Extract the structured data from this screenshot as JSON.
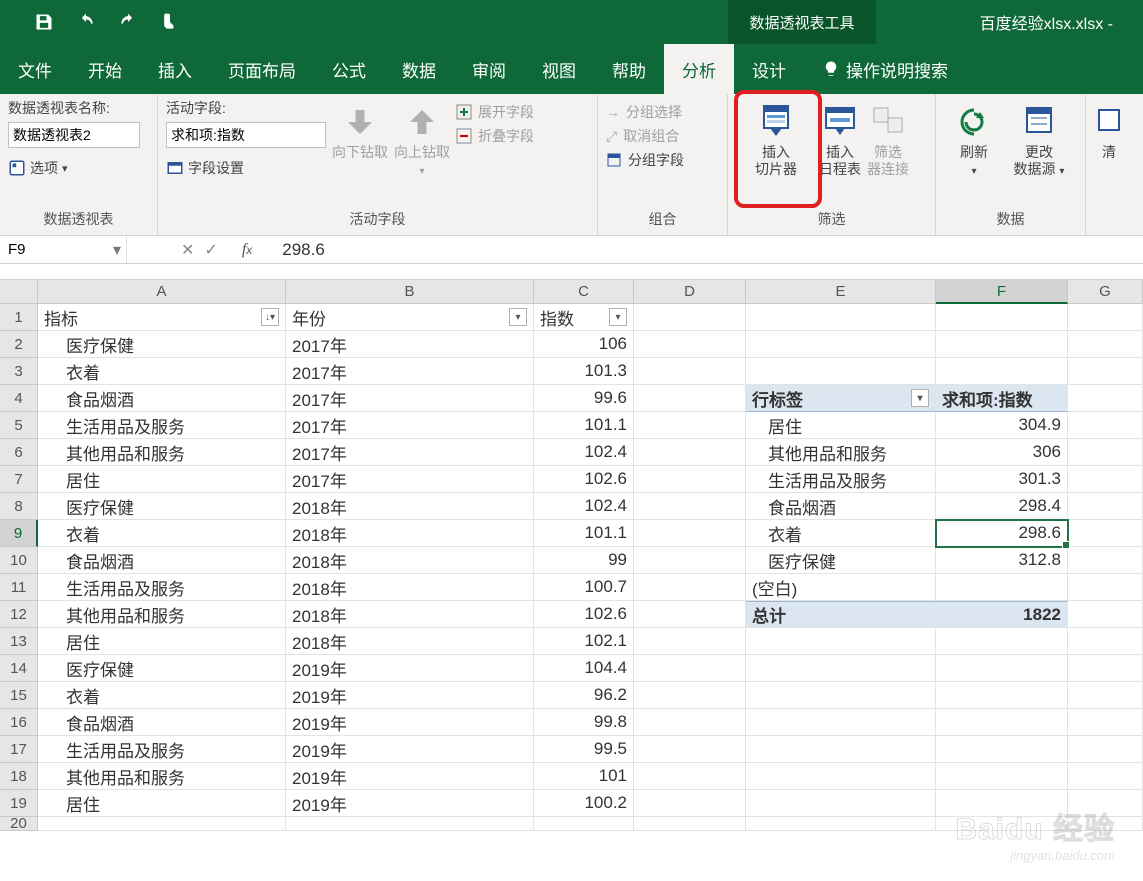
{
  "title": {
    "context_tab": "数据透视表工具",
    "filename": "百度经验xlsx.xlsx -"
  },
  "tabs": [
    "文件",
    "开始",
    "插入",
    "页面布局",
    "公式",
    "数据",
    "审阅",
    "视图",
    "帮助",
    "分析",
    "设计"
  ],
  "tell_me": "操作说明搜索",
  "ribbon": {
    "g1": {
      "label": "数据透视表名称:",
      "value": "数据透视表2",
      "options": "选项",
      "group": "数据透视表"
    },
    "g2": {
      "label": "活动字段:",
      "value": "求和项:指数",
      "settings": "字段设置",
      "drilldown": "向下钻取",
      "drillup": "向上钻取",
      "expand": "展开字段",
      "collapse": "折叠字段",
      "group": "活动字段"
    },
    "g3": {
      "sel": "分组选择",
      "ungroup": "取消组合",
      "field": "分组字段",
      "group": "组合"
    },
    "g4": {
      "slicer1": "插入",
      "slicer2": "切片器",
      "timeline1": "插入",
      "timeline2": "日程表",
      "conn1": "筛选",
      "conn2": "器连接",
      "group": "筛选"
    },
    "g5": {
      "refresh": "刷新",
      "source1": "更改",
      "source2": "数据源",
      "group": "数据"
    },
    "g6": {
      "clear": "清"
    }
  },
  "namebox": "F9",
  "formula": "298.6",
  "columns": [
    "A",
    "B",
    "C",
    "D",
    "E",
    "F",
    "G"
  ],
  "headers": {
    "A": "指标",
    "B": "年份",
    "C": "指数"
  },
  "rows": [
    {
      "n": "1"
    },
    {
      "n": "2",
      "a": "医疗保健",
      "b": "2017年",
      "c": "106"
    },
    {
      "n": "3",
      "a": "衣着",
      "b": "2017年",
      "c": "101.3"
    },
    {
      "n": "4",
      "a": "食品烟酒",
      "b": "2017年",
      "c": "99.6"
    },
    {
      "n": "5",
      "a": "生活用品及服务",
      "b": "2017年",
      "c": "101.1"
    },
    {
      "n": "6",
      "a": "其他用品和服务",
      "b": "2017年",
      "c": "102.4"
    },
    {
      "n": "7",
      "a": "居住",
      "b": "2017年",
      "c": "102.6"
    },
    {
      "n": "8",
      "a": "医疗保健",
      "b": "2018年",
      "c": "102.4"
    },
    {
      "n": "9",
      "a": "衣着",
      "b": "2018年",
      "c": "101.1"
    },
    {
      "n": "10",
      "a": "食品烟酒",
      "b": "2018年",
      "c": "99"
    },
    {
      "n": "11",
      "a": "生活用品及服务",
      "b": "2018年",
      "c": "100.7"
    },
    {
      "n": "12",
      "a": "其他用品和服务",
      "b": "2018年",
      "c": "102.6"
    },
    {
      "n": "13",
      "a": "居住",
      "b": "2018年",
      "c": "102.1"
    },
    {
      "n": "14",
      "a": "医疗保健",
      "b": "2019年",
      "c": "104.4"
    },
    {
      "n": "15",
      "a": "衣着",
      "b": "2019年",
      "c": "96.2"
    },
    {
      "n": "16",
      "a": "食品烟酒",
      "b": "2019年",
      "c": "99.8"
    },
    {
      "n": "17",
      "a": "生活用品及服务",
      "b": "2019年",
      "c": "99.5"
    },
    {
      "n": "18",
      "a": "其他用品和服务",
      "b": "2019年",
      "c": "101"
    },
    {
      "n": "19",
      "a": "居住",
      "b": "2019年",
      "c": "100.2"
    },
    {
      "n": "20"
    }
  ],
  "pivot": {
    "row_label": "行标签",
    "sum_label": "求和项:指数",
    "items": [
      {
        "label": "居住",
        "value": "304.9"
      },
      {
        "label": "其他用品和服务",
        "value": "306"
      },
      {
        "label": "生活用品及服务",
        "value": "301.3"
      },
      {
        "label": "食品烟酒",
        "value": "298.4"
      },
      {
        "label": "衣着",
        "value": "298.6"
      },
      {
        "label": "医疗保健",
        "value": "312.8"
      }
    ],
    "blank": "(空白)",
    "total_label": "总计",
    "total_value": "1822"
  },
  "watermark": {
    "brand": "Baidu 经验",
    "url": "jingyan.baidu.com"
  }
}
